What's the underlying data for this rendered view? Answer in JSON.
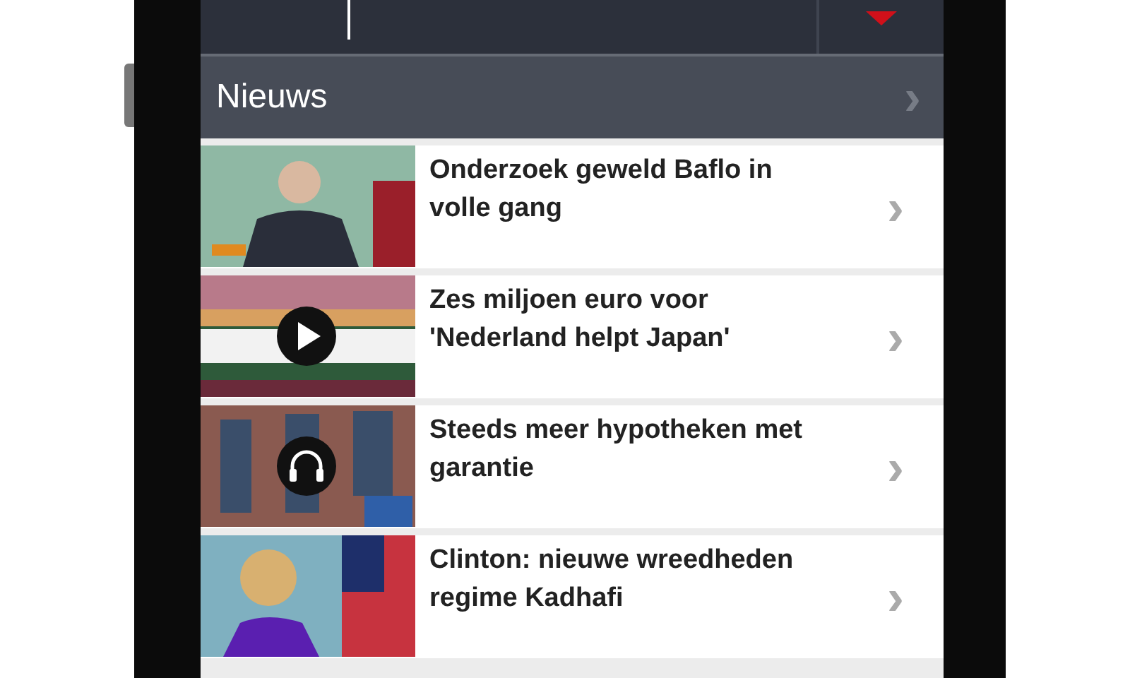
{
  "section": {
    "title": "Nieuws",
    "chevron": "›"
  },
  "articles": [
    {
      "title": "Onderzoek geweld Baflo in volle gang",
      "chevron": "›"
    },
    {
      "title": "Zes miljoen euro voor 'Nederland helpt Japan'",
      "kind": "video",
      "chevron": "›"
    },
    {
      "title": "Steeds meer hypotheken met garantie",
      "kind": "audio",
      "chevron": "›"
    },
    {
      "title": "Clinton: nieuwe wreedheden regime Kadhafi",
      "chevron": "›"
    }
  ]
}
